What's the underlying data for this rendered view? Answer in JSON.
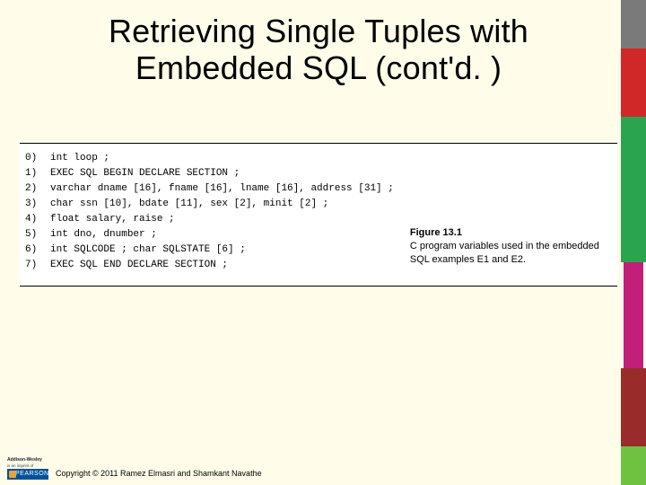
{
  "title": "Retrieving Single Tuples with Embedded SQL (cont'd. )",
  "code": {
    "lines": [
      {
        "n": "0)",
        "t": "int loop ;"
      },
      {
        "n": "1)",
        "t": "EXEC SQL BEGIN DECLARE SECTION ;"
      },
      {
        "n": "2)",
        "t": "varchar dname [16], fname [16], lname [16], address [31] ;"
      },
      {
        "n": "3)",
        "t": "char ssn [10], bdate [11], sex [2], minit [2] ;"
      },
      {
        "n": "4)",
        "t": "float salary, raise ;"
      },
      {
        "n": "5)",
        "t": "int dno, dnumber ;"
      },
      {
        "n": "6)",
        "t": "int SQLCODE ; char SQLSTATE [6] ;"
      },
      {
        "n": "7)",
        "t": "EXEC SQL END DECLARE SECTION ;"
      }
    ]
  },
  "figure": {
    "label": "Figure 13.1",
    "text": "C program variables used in the embedded SQL examples E1 and E2."
  },
  "publisher": {
    "brand_line1": "Addison-Wesley",
    "brand_line2": "is an imprint of",
    "name": "PEARSON"
  },
  "copyright": "Copyright © 2011 Ramez Elmasri and Shamkant Navathe"
}
